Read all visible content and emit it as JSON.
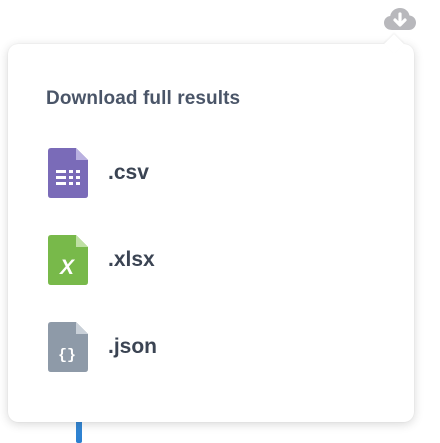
{
  "header": {
    "download_icon": "cloud-download-icon",
    "icon_color": "#b8b8bc"
  },
  "popover": {
    "title": "Download full results",
    "options": [
      {
        "label": ".csv",
        "icon": "file-csv-icon",
        "color": "#7a6bb8"
      },
      {
        "label": ".xlsx",
        "icon": "file-xlsx-icon",
        "color": "#78b94a"
      },
      {
        "label": ".json",
        "icon": "file-json-icon",
        "color": "#8e9aa8"
      }
    ]
  }
}
